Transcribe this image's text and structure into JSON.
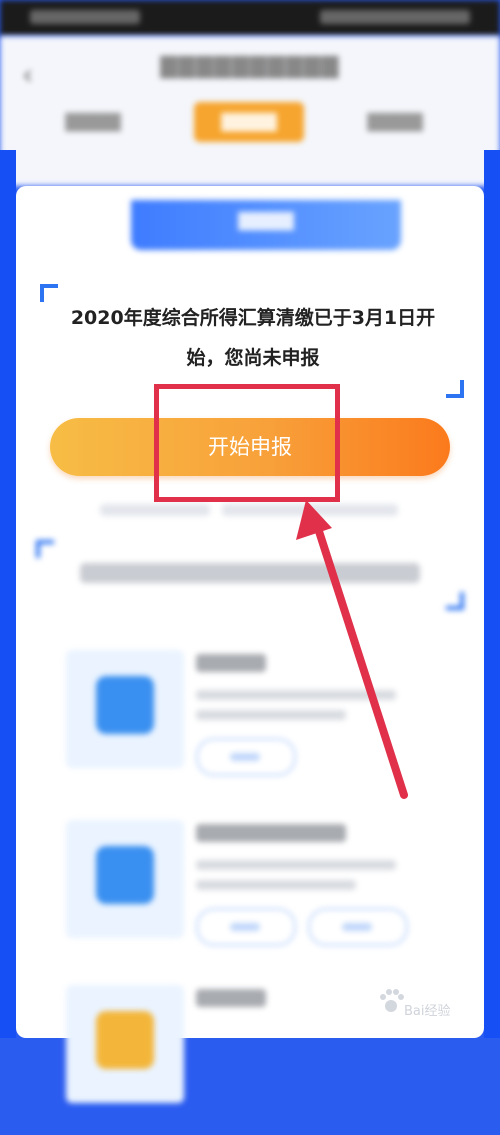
{
  "notice": {
    "line1": "2020年度综合所得汇算清缴已于3月1日开",
    "line2": "始，您尚未申报"
  },
  "start_button": {
    "label": "开始申报"
  },
  "colors": {
    "accent_orange": "#fb7a1c",
    "frame_blue": "#1650f5",
    "annotation_red": "#e0304a"
  },
  "watermark": {
    "text": "Bai经验"
  }
}
